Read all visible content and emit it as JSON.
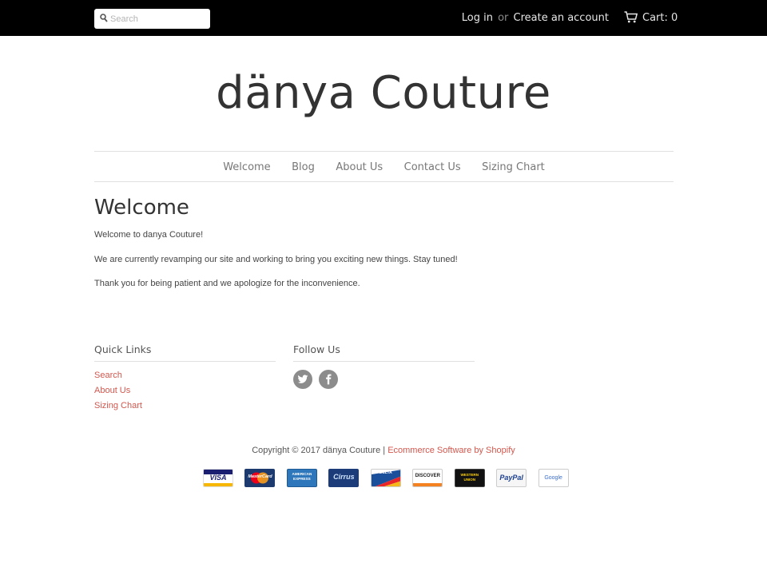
{
  "topbar": {
    "search_placeholder": "Search",
    "login_label": "Log in",
    "or_label": "or",
    "create_account_label": "Create an account",
    "cart_label": "Cart: 0"
  },
  "header": {
    "logo": "dänya Couture"
  },
  "nav": {
    "items": [
      {
        "label": "Welcome"
      },
      {
        "label": "Blog"
      },
      {
        "label": "About Us"
      },
      {
        "label": "Contact Us"
      },
      {
        "label": "Sizing Chart"
      }
    ]
  },
  "main": {
    "title": "Welcome",
    "paragraphs": [
      "Welcome to danya Couture!",
      "We are currently revamping our site and working to bring you exciting new things. Stay tuned!",
      "Thank you for being patient and we apologize for the inconvenience."
    ]
  },
  "footer": {
    "quick_links": {
      "heading": "Quick Links",
      "items": [
        "Search",
        "About Us",
        "Sizing Chart"
      ]
    },
    "follow_us": {
      "heading": "Follow Us",
      "icons": [
        "twitter-icon",
        "facebook-icon"
      ]
    },
    "copyright_text": "Copyright © 2017 dänya Couture | ",
    "shopify_link": "Ecommerce Software by Shopify",
    "accent_color": "#d3574d",
    "payment_methods": [
      {
        "name": "VISA",
        "icon": "visa-icon"
      },
      {
        "name": "MasterCard",
        "icon": "mastercard-icon"
      },
      {
        "name": "AMERICAN EXPRESS",
        "icon": "amex-icon"
      },
      {
        "name": "Cirrus",
        "icon": "cirrus-icon"
      },
      {
        "name": "DELTA",
        "icon": "delta-icon"
      },
      {
        "name": "DISCOVER",
        "icon": "discover-icon"
      },
      {
        "name": "WESTERN UNION",
        "icon": "western-union-icon"
      },
      {
        "name": "PayPal",
        "icon": "paypal-icon"
      },
      {
        "name": "Google",
        "icon": "google-checkout-icon"
      }
    ]
  }
}
